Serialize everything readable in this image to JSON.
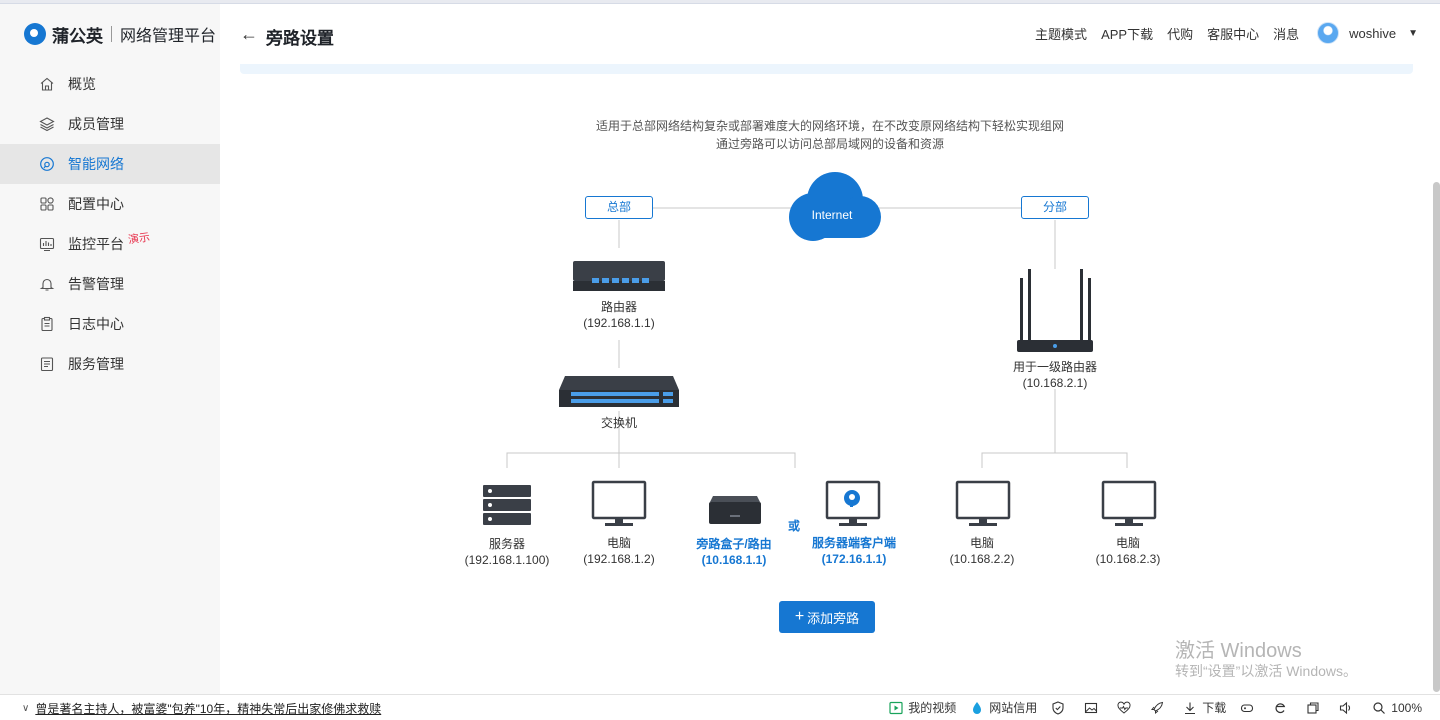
{
  "brand": {
    "name": "蒲公英",
    "subtitle": "网络管理平台"
  },
  "sidebar": {
    "items": [
      {
        "label": "概览",
        "icon": "home-icon"
      },
      {
        "label": "成员管理",
        "icon": "layers-icon"
      },
      {
        "label": "智能网络",
        "icon": "network-icon",
        "active": true
      },
      {
        "label": "配置中心",
        "icon": "grid-icon"
      },
      {
        "label": "监控平台",
        "icon": "monitor-icon",
        "badge": "演示"
      },
      {
        "label": "告警管理",
        "icon": "bell-icon"
      },
      {
        "label": "日志中心",
        "icon": "clipboard-icon"
      },
      {
        "label": "服务管理",
        "icon": "document-icon"
      }
    ]
  },
  "header": {
    "title": "旁路设置",
    "links": [
      "主题模式",
      "APP下载",
      "代购",
      "客服中心",
      "消息"
    ],
    "user": "woshive"
  },
  "description": {
    "line1": "适用于总部网络结构复杂或部署难度大的网络环境，在不改变原网络结构下轻松实现组网",
    "line2": "通过旁路可以访问总部局域网的设备和资源"
  },
  "diagram": {
    "internet": "Internet",
    "hq_tag": "总部",
    "branch_tag": "分部",
    "router": {
      "name": "路由器",
      "ip": "(192.168.1.1)"
    },
    "switch": {
      "name": "交换机"
    },
    "server": {
      "name": "服务器",
      "ip": "(192.168.1.100)"
    },
    "pc1": {
      "name": "电脑",
      "ip": "(192.168.1.2)"
    },
    "bypass_box": {
      "name": "旁路盒子/路由",
      "ip": "(10.168.1.1)"
    },
    "or": "或",
    "server_client": {
      "name": "服务器端客户端",
      "ip": "(172.16.1.1)"
    },
    "branch_router": {
      "name": "用于一级路由器",
      "ip": "(10.168.2.1)"
    },
    "pc2": {
      "name": "电脑",
      "ip": "(10.168.2.2)"
    },
    "pc3": {
      "name": "电脑",
      "ip": "(10.168.2.3)"
    }
  },
  "add_button": {
    "plus": "+",
    "label": "添加旁路"
  },
  "watermark": {
    "line1": "激活 Windows",
    "line2": "转到“设置”以激活 Windows。"
  },
  "statusbar": {
    "news": "曾是著名主持人，被富婆\"包养\"10年，精神失常后出家修佛求救赎",
    "video": "我的视频",
    "credit": "网站信用",
    "download": "下载",
    "zoom": "100%"
  },
  "colors": {
    "accent": "#1677d2",
    "badge": "#e8344e"
  }
}
